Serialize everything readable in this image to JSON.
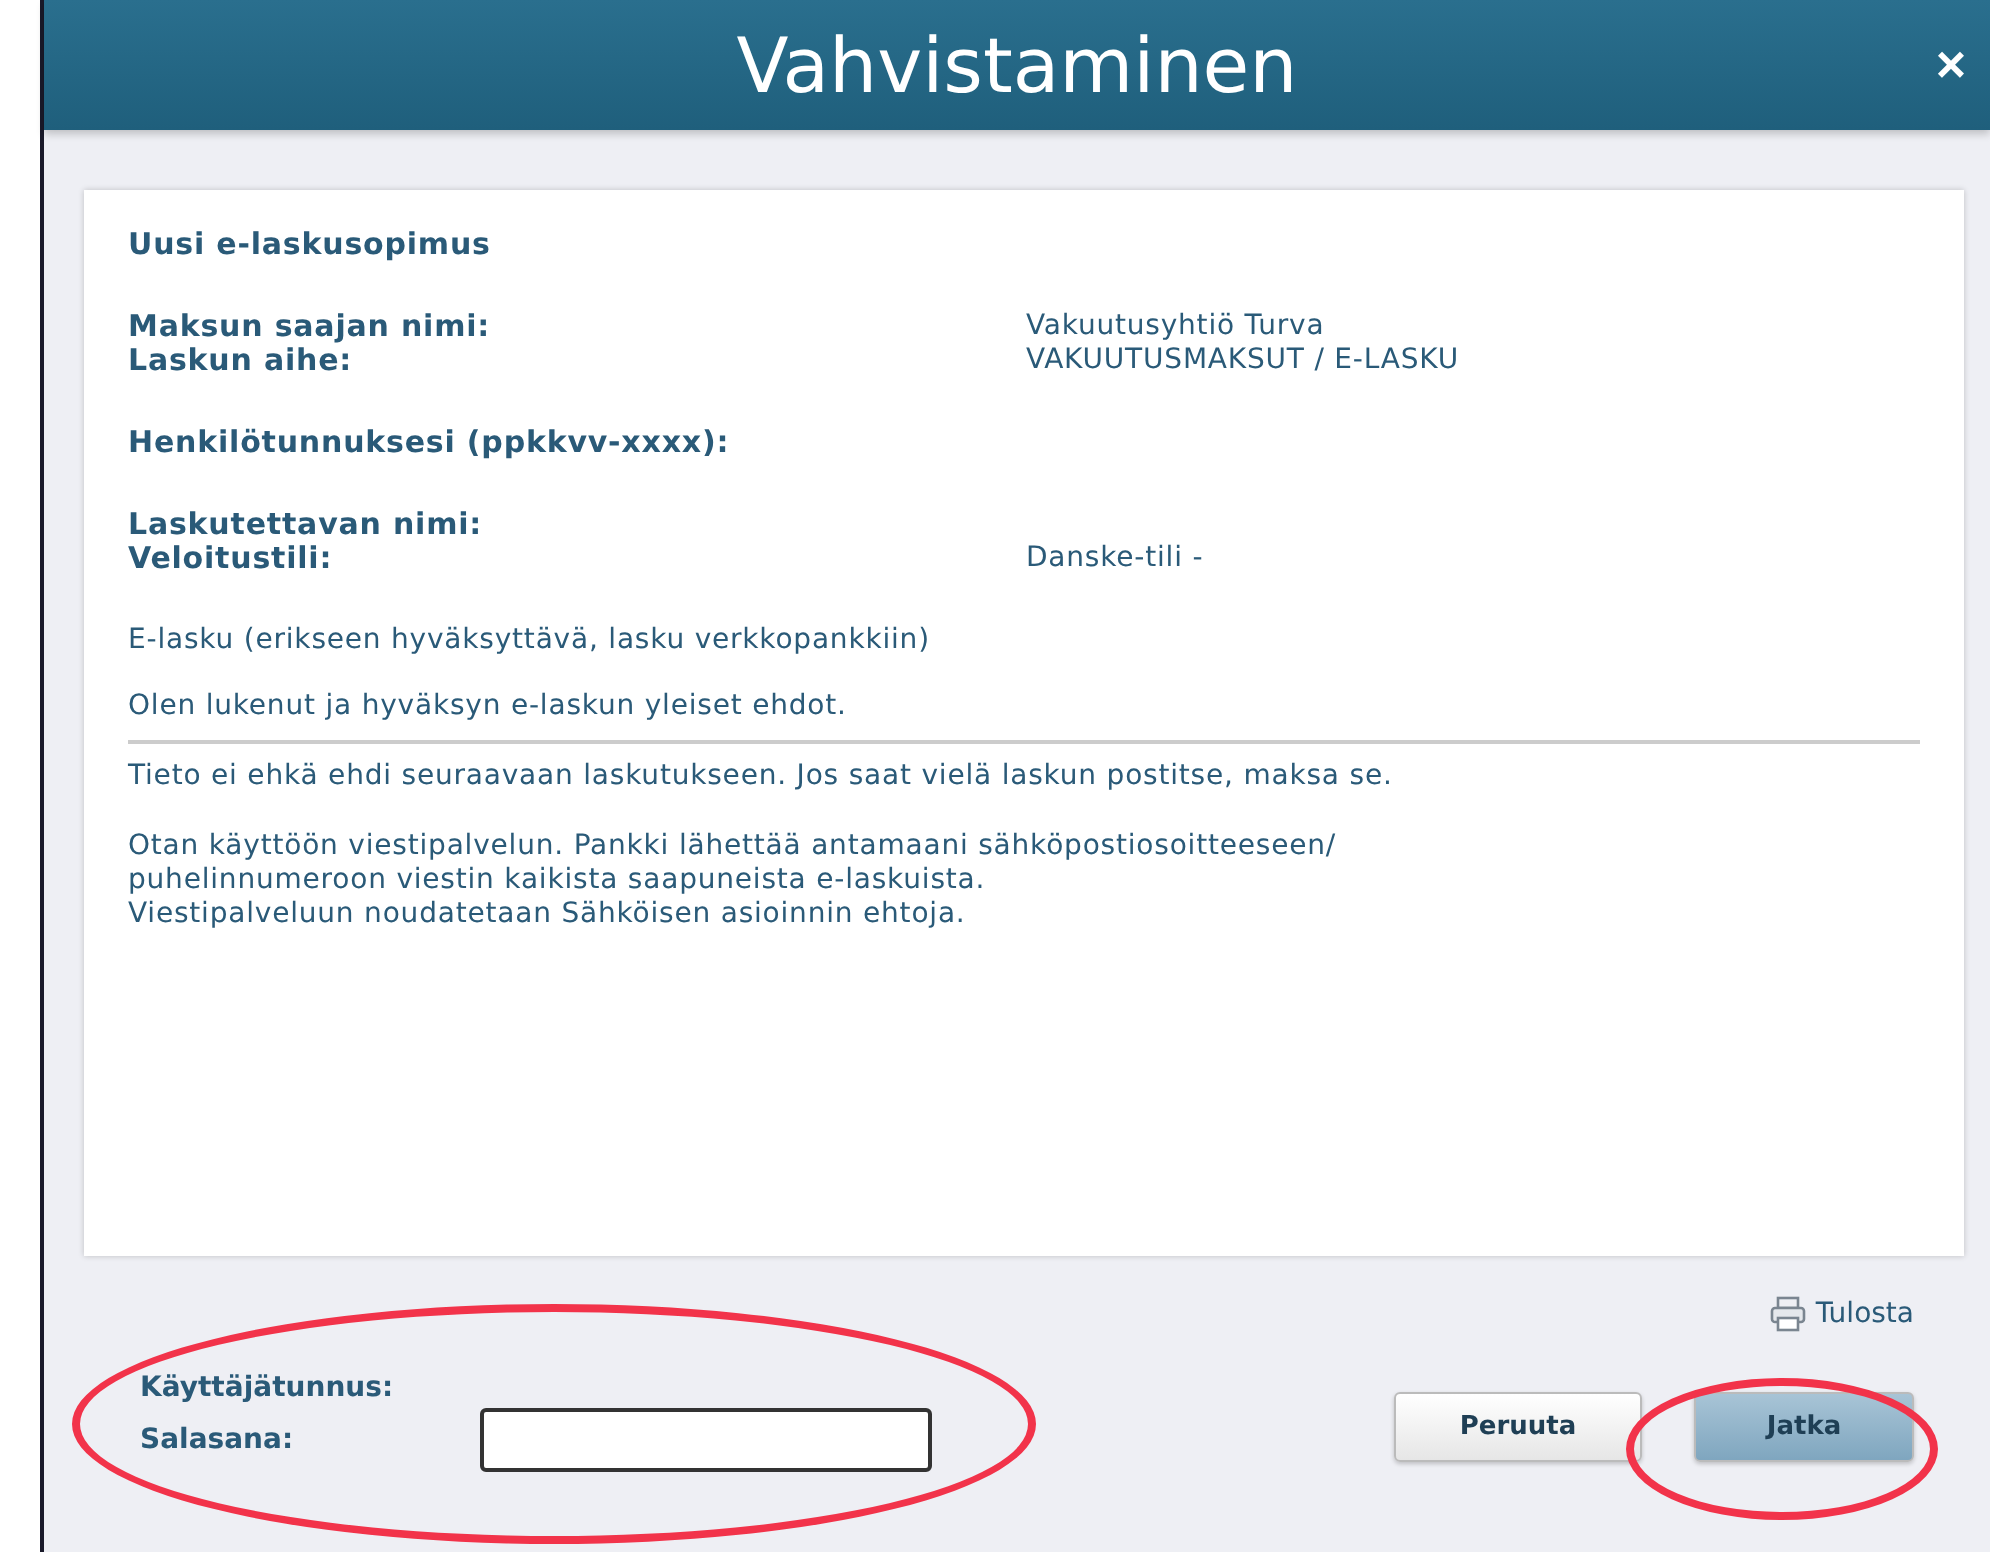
{
  "window": {
    "title": "Vahvistaminen",
    "close": "×"
  },
  "agreement": {
    "heading": "Uusi e-laskusopimus",
    "field_groups": [
      [
        {
          "label": "Maksun saajan nimi:",
          "value": "Vakuutusyhtiö Turva"
        },
        {
          "label": "Laskun aihe:",
          "value": "VAKUUTUSMAKSUT / E-LASKU"
        }
      ],
      [
        {
          "label": "Henkilötunnuksesi (ppkkvv-xxxx):"
        }
      ],
      [
        {
          "label": "Laskutettavan nimi:"
        },
        {
          "label": "Veloitustili:",
          "value": "Danske-tili -"
        }
      ]
    ],
    "invoice_type": "E-lasku (erikseen hyväksyttävä, lasku verkkopankkiin)",
    "terms": "Olen lukenut ja hyväksyn e-laskun yleiset ehdot.",
    "notes": [
      "Tieto ei ehkä ehdi seuraavaan laskutukseen. Jos saat vielä laskun postitse, maksa se.",
      "Otan käyttöön viestipalvelun. Pankki lähettää antamaani sähköpostiosoitteeseen/\npuhelinnumeroon viestin kaikista saapuneista e-laskuista.\nViestipalveluun noudatetaan Sähköisen asioinnin ehtoja."
    ]
  },
  "print_link": "Tulosta",
  "login": {
    "username_label": "Käyttäjätunnus:",
    "password_label": "Salasana:"
  },
  "buttons": [
    {
      "label": "Peruuta",
      "kind": "secondary"
    },
    {
      "label": "Jatka",
      "kind": "primary"
    }
  ]
}
